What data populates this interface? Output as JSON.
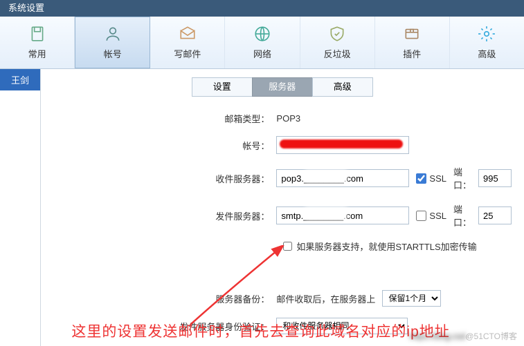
{
  "window": {
    "title": "系统设置"
  },
  "toolbar": {
    "items": [
      {
        "label": "常用"
      },
      {
        "label": "帐号"
      },
      {
        "label": "写邮件"
      },
      {
        "label": "网络"
      },
      {
        "label": "反垃圾"
      },
      {
        "label": "插件"
      },
      {
        "label": "高级"
      }
    ]
  },
  "sidebar": {
    "accounts": [
      "王剑"
    ]
  },
  "tabs": {
    "settings": "设置",
    "server": "服务器",
    "advanced": "高级"
  },
  "form": {
    "mailbox_type_label": "邮箱类型：",
    "mailbox_type_value": "POP3",
    "account_label": "帐号：",
    "incoming_label": "收件服务器：",
    "incoming_value": "pop3.________.com",
    "incoming_ssl": true,
    "ssl_label": "SSL",
    "port_label": "端口：",
    "incoming_port": "995",
    "outgoing_label": "发件服务器：",
    "outgoing_value": "smtp.________.com",
    "outgoing_ssl": false,
    "outgoing_port": "25",
    "starttls_label": "如果服务器支持，就使用STARTTLS加密传输",
    "backup_label": "服务器备份：",
    "backup_text": "邮件收取后，在服务器上",
    "backup_select": "保留1个月",
    "auth_label": "发件服务器身份验证：",
    "auth_select": "和收件服务器相同"
  },
  "annotation": "这里的设置发送邮件时，首先去查询此域名对应的ip地址",
  "watermark": "@51CTO博客"
}
